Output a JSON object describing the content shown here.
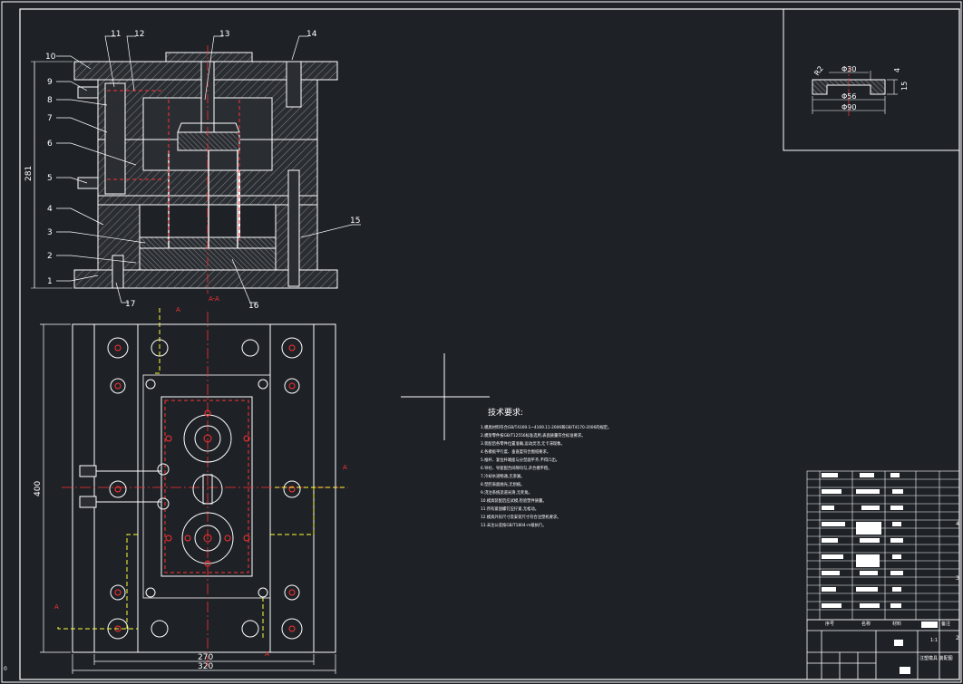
{
  "part_callouts": [
    "1",
    "2",
    "3",
    "4",
    "5",
    "6",
    "7",
    "8",
    "9",
    "10",
    "11",
    "12",
    "13",
    "14",
    "15",
    "16",
    "17"
  ],
  "dimensions": {
    "section_height": "281",
    "plan_height": "400",
    "plan_inner_width": "270",
    "plan_outer_width": "320",
    "detail_dia_top": "Φ30",
    "detail_dia_mid": "Φ56",
    "detail_dia_bottom": "Φ90",
    "detail_height": "15",
    "detail_thickness": "4",
    "detail_radius": "R2"
  },
  "section_marks": {
    "section_label": "A-A",
    "cut_letter": "A"
  },
  "tech_requirements": {
    "title": "技术要求:",
    "lines": [
      "1.模具材料符合GB/T4169.1~4169.11-2006和GB/T4170-2006的规定。",
      "2.模架零件按GB/T12556标准选用,表面质量符合标准要求。",
      "3.装配后各零件位置准确,运动灵活,无卡滞现象。",
      "4.各模板平行度、垂直度符合图纸要求。",
      "5.推杆、复位杆端面与分型面平齐,不得凸出。",
      "6.导柱、导套配合间隙均匀,开合模平稳。",
      "7.冷却水道畅通,无渗漏。",
      "8.型腔表面抛光,无划痕。",
      "9.浇注系统流道光滑,无死角。",
      "10.模具装配后应试模,检验塑件质量。",
      "11.所有紧固螺钉应拧紧,无松动。",
      "12.模具外形尺寸及安装尺寸符合注塑机要求。",
      "13.未注公差按GB/T1804-m级执行。"
    ]
  },
  "title_block": {
    "col_no": "序号",
    "col_name": "名称",
    "col_material": "材料",
    "col_remark": "备注",
    "drawing_title": "注塑模具 装配图",
    "drawing_no": "1:1"
  },
  "colors": {
    "background": "#1e2227",
    "line": "#ffffff",
    "hidden": "#ff3030",
    "centerline": "#ff3030",
    "cooling": "#ffff33",
    "dimension": "#ffffff"
  }
}
